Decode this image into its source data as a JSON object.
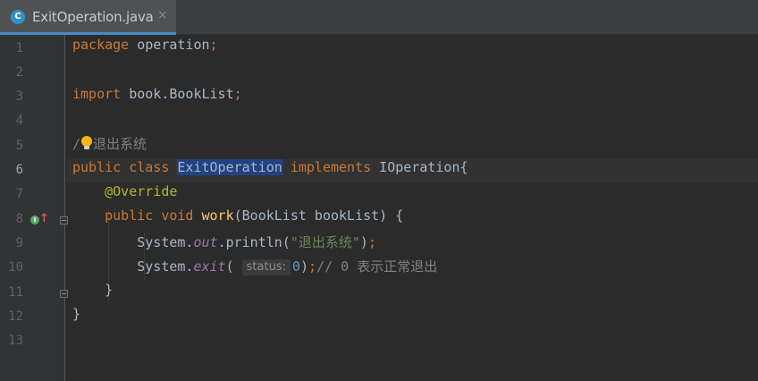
{
  "tab": {
    "icon_letter": "C",
    "filename": "ExitOperation.java",
    "close": "×"
  },
  "gutter": {
    "line_numbers": [
      "1",
      "2",
      "3",
      "4",
      "5",
      "6",
      "7",
      "8",
      "9",
      "10",
      "11",
      "12",
      "13"
    ],
    "current_line": "6",
    "override_marker": "I"
  },
  "code": {
    "l1": {
      "kw": "package",
      "rest": " operation",
      "semi": ";"
    },
    "l3": {
      "kw": "import",
      "rest": " book.BookList",
      "semi": ";"
    },
    "l5": {
      "slash": "/",
      "comment": "退出系统"
    },
    "l6": {
      "kw1": "public",
      "kw2": "class",
      "name": "ExitOperation",
      "kw3": "implements",
      "rest": " IOperation{"
    },
    "l7": {
      "ann": "@Override"
    },
    "l8": {
      "kw1": "public",
      "kw2": "void",
      "fn": "work",
      "rest": "(BookList bookList) {"
    },
    "l9": {
      "a": "System.",
      "field": "out",
      "b": ".println(",
      "str": "\"退出系统\"",
      "c": ")",
      "semi": ";"
    },
    "l10": {
      "a": "System.",
      "method": "exit",
      "b": "(",
      "hint": "status:",
      "num": "0",
      "c": ")",
      "semi": ";",
      "comment_a": "// 0 ",
      "comment_b": "表示正常退出"
    },
    "l11": {
      "brace": "}"
    },
    "l12": {
      "brace": "}"
    }
  }
}
